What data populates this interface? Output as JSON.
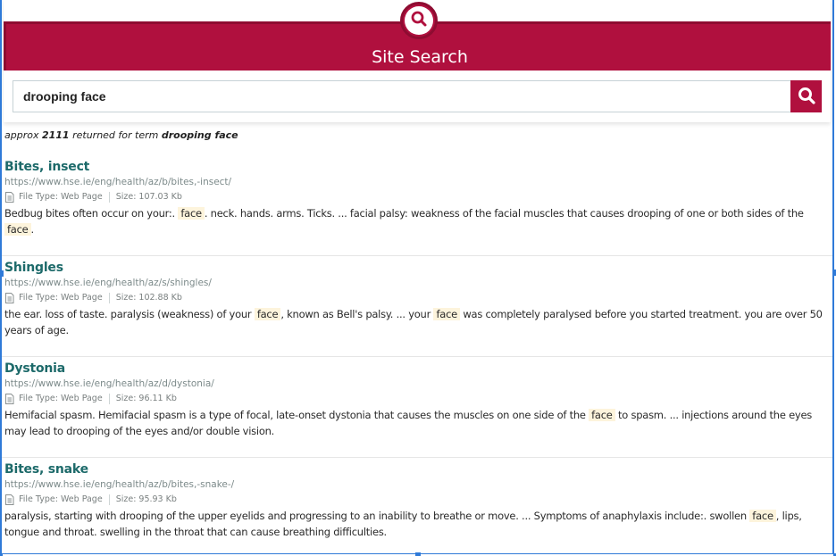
{
  "header": {
    "title": "Site Search",
    "icon": "search-icon",
    "brand_color": "#b0103e"
  },
  "search": {
    "value": "drooping face",
    "placeholder": "",
    "button_icon": "search-icon"
  },
  "summary": {
    "prefix": "approx",
    "count": "2111",
    "middle": "returned for term",
    "term": "drooping face"
  },
  "results": [
    {
      "title": "Bites, insect",
      "url": "https://www.hse.ie/eng/health/az/b/bites,-insect/",
      "file_type_label": "File Type: Web Page",
      "size_label": "Size: 107.03 Kb",
      "snippet": [
        {
          "text": "Bedbug bites often occur on your:. "
        },
        {
          "text": "face",
          "highlight": true
        },
        {
          "text": ". neck. hands. arms. Ticks. ... facial palsy: weakness of the facial muscles that causes drooping of one or both sides of the "
        },
        {
          "text": "face",
          "highlight": true
        },
        {
          "text": "."
        }
      ]
    },
    {
      "title": "Shingles",
      "url": "https://www.hse.ie/eng/health/az/s/shingles/",
      "file_type_label": "File Type: Web Page",
      "size_label": "Size: 102.88 Kb",
      "snippet": [
        {
          "text": "the ear. loss of taste. paralysis (weakness) of your "
        },
        {
          "text": "face",
          "highlight": true
        },
        {
          "text": ", known as Bell's palsy. ... your "
        },
        {
          "text": "face",
          "highlight": true
        },
        {
          "text": " was completely paralysed before you started treatment. you are over 50 years of age."
        }
      ]
    },
    {
      "title": "Dystonia",
      "url": "https://www.hse.ie/eng/health/az/d/dystonia/",
      "file_type_label": "File Type: Web Page",
      "size_label": "Size: 96.11 Kb",
      "snippet": [
        {
          "text": "Hemifacial spasm. Hemifacial spasm is a type of focal, late-onset dystonia that causes the muscles on one side of the "
        },
        {
          "text": "face",
          "highlight": true
        },
        {
          "text": " to spasm. ... injections around the eyes may lead to drooping of the eyes and/or double vision."
        }
      ]
    },
    {
      "title": "Bites, snake",
      "url": "https://www.hse.ie/eng/health/az/b/bites,-snake-/",
      "file_type_label": "File Type: Web Page",
      "size_label": "Size: 95.93 Kb",
      "snippet": [
        {
          "text": "paralysis,  starting with drooping of the upper eyelids and progressing to an inability to breathe or move. ... Symptoms of anaphylaxis include:. swollen "
        },
        {
          "text": "face",
          "highlight": true
        },
        {
          "text": ", lips, tongue and throat. swelling in the throat that can cause breathing difficulties."
        }
      ]
    }
  ],
  "colors": {
    "title_link": "#1d6a6a",
    "url": "#7c8a8a",
    "highlight_bg": "#fdf4dc",
    "selection_frame": "#2f7ad8"
  }
}
